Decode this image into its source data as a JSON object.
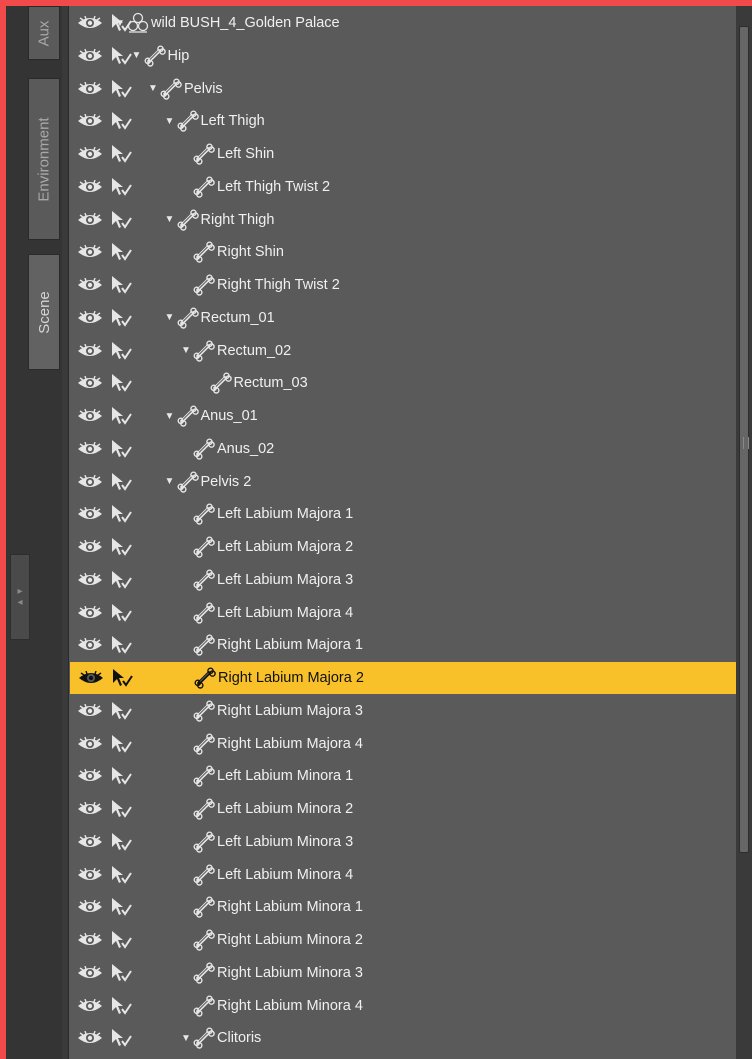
{
  "tabs": [
    {
      "label": "Aux",
      "active": false
    },
    {
      "label": "Environment",
      "active": false
    },
    {
      "label": "Scene",
      "active": true
    }
  ],
  "colors": {
    "selected_row": "#f8c12a",
    "panel_bg": "#5a5a5a",
    "window_border": "#f04a4a"
  },
  "icons": {
    "visibility": "eye-icon",
    "selectable": "cursor-check-icon",
    "bone": "bone-icon",
    "figure": "figure-icon",
    "expand": "triangle-down-icon"
  },
  "tree": [
    {
      "label": "wild BUSH_4_Golden Palace",
      "depth": 0,
      "expanded": true,
      "type": "figure"
    },
    {
      "label": "Hip",
      "depth": 1,
      "expanded": true,
      "type": "bone"
    },
    {
      "label": "Pelvis",
      "depth": 2,
      "expanded": true,
      "type": "bone"
    },
    {
      "label": "Left Thigh",
      "depth": 3,
      "expanded": true,
      "type": "bone"
    },
    {
      "label": "Left Shin",
      "depth": 4,
      "expanded": false,
      "type": "bone"
    },
    {
      "label": "Left Thigh Twist 2",
      "depth": 4,
      "expanded": false,
      "type": "bone"
    },
    {
      "label": "Right Thigh",
      "depth": 3,
      "expanded": true,
      "type": "bone"
    },
    {
      "label": "Right Shin",
      "depth": 4,
      "expanded": false,
      "type": "bone"
    },
    {
      "label": "Right Thigh Twist 2",
      "depth": 4,
      "expanded": false,
      "type": "bone"
    },
    {
      "label": "Rectum_01",
      "depth": 3,
      "expanded": true,
      "type": "bone"
    },
    {
      "label": "Rectum_02",
      "depth": 4,
      "expanded": true,
      "type": "bone"
    },
    {
      "label": "Rectum_03",
      "depth": 5,
      "expanded": false,
      "type": "bone"
    },
    {
      "label": "Anus_01",
      "depth": 3,
      "expanded": true,
      "type": "bone"
    },
    {
      "label": "Anus_02",
      "depth": 4,
      "expanded": false,
      "type": "bone"
    },
    {
      "label": "Pelvis 2",
      "depth": 3,
      "expanded": true,
      "type": "bone"
    },
    {
      "label": "Left Labium Majora 1",
      "depth": 4,
      "expanded": false,
      "type": "bone"
    },
    {
      "label": "Left Labium Majora 2",
      "depth": 4,
      "expanded": false,
      "type": "bone"
    },
    {
      "label": "Left Labium Majora 3",
      "depth": 4,
      "expanded": false,
      "type": "bone"
    },
    {
      "label": "Left Labium Majora 4",
      "depth": 4,
      "expanded": false,
      "type": "bone"
    },
    {
      "label": "Right Labium Majora 1",
      "depth": 4,
      "expanded": false,
      "type": "bone"
    },
    {
      "label": "Right Labium Majora 2",
      "depth": 4,
      "expanded": false,
      "type": "bone",
      "selected": true
    },
    {
      "label": "Right Labium Majora 3",
      "depth": 4,
      "expanded": false,
      "type": "bone"
    },
    {
      "label": "Right Labium Majora 4",
      "depth": 4,
      "expanded": false,
      "type": "bone"
    },
    {
      "label": "Left Labium Minora 1",
      "depth": 4,
      "expanded": false,
      "type": "bone"
    },
    {
      "label": "Left Labium Minora 2",
      "depth": 4,
      "expanded": false,
      "type": "bone"
    },
    {
      "label": "Left Labium Minora 3",
      "depth": 4,
      "expanded": false,
      "type": "bone"
    },
    {
      "label": "Left Labium Minora 4",
      "depth": 4,
      "expanded": false,
      "type": "bone"
    },
    {
      "label": "Right Labium Minora 1",
      "depth": 4,
      "expanded": false,
      "type": "bone"
    },
    {
      "label": "Right Labium Minora 2",
      "depth": 4,
      "expanded": false,
      "type": "bone"
    },
    {
      "label": "Right Labium Minora 3",
      "depth": 4,
      "expanded": false,
      "type": "bone"
    },
    {
      "label": "Right Labium Minora 4",
      "depth": 4,
      "expanded": false,
      "type": "bone"
    },
    {
      "label": "Clitoris",
      "depth": 4,
      "expanded": true,
      "type": "bone"
    }
  ]
}
